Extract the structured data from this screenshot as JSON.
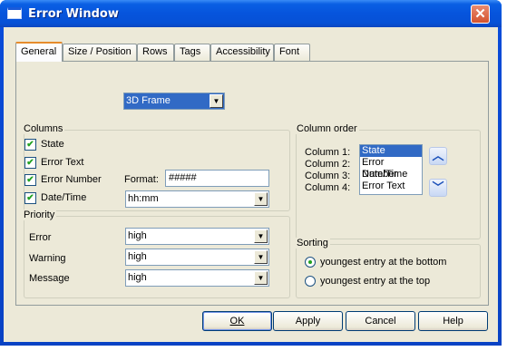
{
  "window": {
    "title": "Error Window"
  },
  "tabs": [
    "General",
    "Size / Position",
    "Rows",
    "Tags",
    "Accessibility",
    "Font"
  ],
  "frame_style": {
    "value": "3D Frame"
  },
  "columns": {
    "label": "Columns",
    "items": [
      {
        "label": "State",
        "checked": true
      },
      {
        "label": "Error Text",
        "checked": true
      },
      {
        "label": "Error Number",
        "checked": true
      },
      {
        "label": "Date/Time",
        "checked": true
      }
    ],
    "format_label": "Format:",
    "format_value": "#####",
    "datetime_format": "hh:mm"
  },
  "priority": {
    "label": "Priority",
    "rows": [
      {
        "label": "Error",
        "value": "high"
      },
      {
        "label": "Warning",
        "value": "high"
      },
      {
        "label": "Message",
        "value": "high"
      }
    ]
  },
  "column_order": {
    "label": "Column order",
    "column_labels": [
      "Column 1:",
      "Column 2:",
      "Column 3:",
      "Column 4:"
    ],
    "items": [
      "State",
      "Error Number",
      "Date/Time",
      "Error Text"
    ],
    "selected_index": 0
  },
  "sorting": {
    "label": "Sorting",
    "options": [
      "youngest entry at the bottom",
      "youngest entry at the top"
    ],
    "selected_index": 0
  },
  "buttons": {
    "ok": "OK",
    "apply": "Apply",
    "cancel": "Cancel",
    "help": "Help"
  },
  "icons": {
    "up": "arrow-up-icon",
    "down": "arrow-down-icon",
    "close": "close-icon"
  }
}
